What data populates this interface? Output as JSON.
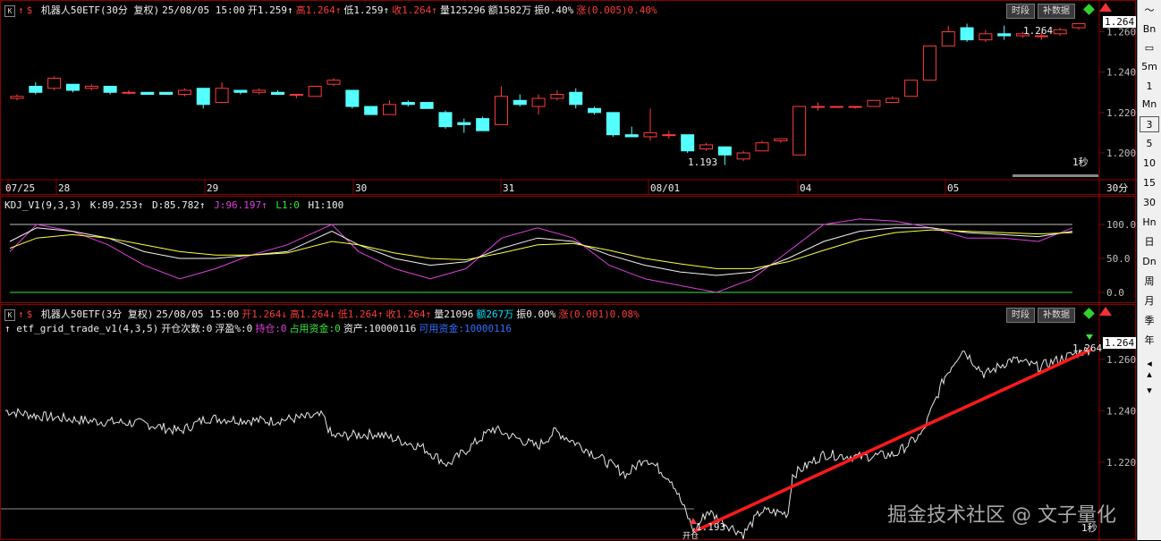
{
  "panel1": {
    "k_label": "K",
    "header": [
      {
        "text": "机器人50ETF(30分 复权)",
        "color": "white"
      },
      {
        "text": "25/08/05 15:00",
        "color": "white"
      },
      {
        "text": "开1.259↑",
        "color": "white"
      },
      {
        "text": "高1.264↑",
        "color": "red"
      },
      {
        "text": "低1.259↑",
        "color": "white"
      },
      {
        "text": "收1.264↑",
        "color": "red"
      },
      {
        "text": "量125296",
        "color": "white"
      },
      {
        "text": "额1582万",
        "color": "white"
      },
      {
        "text": "振0.40%",
        "color": "white"
      },
      {
        "text": "涨(0.005)0.40%",
        "color": "red"
      }
    ],
    "btn_period": "时段",
    "btn_data": "补数据",
    "price_tag": "1.264",
    "y_ticks": [
      "1.260",
      "1.240",
      "1.220",
      "1.200"
    ],
    "high_label": "1.264",
    "low_label": "1.193",
    "sec_label": "1秒",
    "date_labels": [
      "07/25",
      "28",
      "29",
      "30",
      "31",
      "08/01",
      "04",
      "05"
    ],
    "period_label": "30分"
  },
  "panel2": {
    "title": "KDJ_V1(9,3,3)",
    "k": "K:89.253↑",
    "d": "D:85.782↑",
    "j": "J:96.197↑",
    "l1": "L1:0",
    "h1": "H1:100",
    "y_ticks": [
      "100.0",
      "50.0",
      "0.0"
    ]
  },
  "panel3": {
    "k_label": "K",
    "header": [
      {
        "text": "机器人50ETF(3分 复权)",
        "color": "white"
      },
      {
        "text": "25/08/05 15:00",
        "color": "white"
      },
      {
        "text": "开1.264↓",
        "color": "red"
      },
      {
        "text": "高1.264↓",
        "color": "red"
      },
      {
        "text": "低1.264↑",
        "color": "red"
      },
      {
        "text": "收1.264↑",
        "color": "red"
      },
      {
        "text": "量21096",
        "color": "white"
      },
      {
        "text": "额267万",
        "color": "cyan"
      },
      {
        "text": "振0.00%",
        "color": "white"
      },
      {
        "text": "涨(0.001)0.08%",
        "color": "red"
      }
    ],
    "strategy": [
      {
        "text": "↑ etf_grid_trade_v1(4,3,5)",
        "color": "white"
      },
      {
        "text": "开仓次数:0",
        "color": "white"
      },
      {
        "text": "浮盈%:0",
        "color": "white"
      },
      {
        "text": "持仓:0",
        "color": "magenta"
      },
      {
        "text": "占用资金:0",
        "color": "green"
      },
      {
        "text": "资产:10000116",
        "color": "white"
      },
      {
        "text": "可用资金:10000116",
        "color": "blue"
      }
    ],
    "btn_period": "时段",
    "btn_data": "补数据",
    "price_tag": "1.264",
    "y_ticks": [
      "1.260",
      "1.240",
      "1.220"
    ],
    "high_label": "1.264",
    "low_label": "1.193",
    "open_label": "开仓",
    "sec_label": "1秒"
  },
  "sidebar": [
    "〜",
    "Bn",
    "▭",
    "5m",
    "1",
    "Mn",
    "3",
    "5",
    "10",
    "15",
    "30",
    "Hn",
    "日",
    "Dn",
    "周",
    "月",
    "季",
    "年",
    "◂",
    "▴",
    "▾"
  ],
  "sidebar_active": 6,
  "watermark": "掘金技术社区 @ 文子量化",
  "colors": {
    "up": "#ff3b3b",
    "down": "#54ffff",
    "frame": "#8b0000",
    "trend": "#ff1a1a"
  }
}
